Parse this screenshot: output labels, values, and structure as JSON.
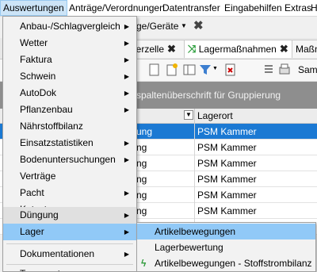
{
  "menubar": [
    "Auswertungen",
    "Anträge/Verordnungen",
    "Datentransfer",
    "Eingabehilfen",
    "Extras",
    "H"
  ],
  "toolbar1": {
    "combo_text": "ge/Geräte"
  },
  "tabs": [
    {
      "label": "gerzelle"
    },
    {
      "label": "Lagermaßnahmen"
    },
    {
      "label": "Maßn"
    }
  ],
  "toolbar2": {
    "partial_text": "Sam"
  },
  "groupbar_text": "spaltenüberschrift für Gruppierung ablegen",
  "grid": {
    "column_header": "Lagerort",
    "rows": [
      {
        "left": "ung",
        "lagerort": "PSM Kammer",
        "selected": true
      },
      {
        "left": "ng",
        "lagerort": "PSM Kammer",
        "selected": false
      },
      {
        "left": "ng",
        "lagerort": "PSM Kammer",
        "selected": false
      },
      {
        "left": "ng",
        "lagerort": "PSM Kammer",
        "selected": false
      },
      {
        "left": "ng",
        "lagerort": "PSM Kammer",
        "selected": false
      },
      {
        "left": "ng",
        "lagerort": "PSM Kammer",
        "selected": false
      },
      {
        "left": "ng",
        "lagerort": "PSM Kammer",
        "selected": false
      }
    ]
  },
  "menu": {
    "items": [
      {
        "label": "Anbau-/Schlagvergleich",
        "submenu": true
      },
      {
        "label": "Wetter",
        "submenu": true
      },
      {
        "label": "Faktura",
        "submenu": true
      },
      {
        "label": "Schwein",
        "submenu": true
      },
      {
        "label": "AutoDok",
        "submenu": true
      },
      {
        "label": "Pflanzenbau",
        "submenu": true
      },
      {
        "label": "Nährstoffbilanz",
        "submenu": false
      },
      {
        "label": "Einsatzstatistiken",
        "submenu": true
      },
      {
        "label": "Bodenuntersuchungen",
        "submenu": true
      },
      {
        "label": "Verträge",
        "submenu": false
      },
      {
        "label": "Pacht",
        "submenu": true
      },
      {
        "label": "Kataster",
        "submenu": true
      },
      {
        "label": "Düngung",
        "submenu": true
      },
      {
        "label": "Lager",
        "submenu": true
      },
      {
        "label": "Dokumentationen",
        "submenu": true
      },
      {
        "label": "Transport",
        "submenu": true
      }
    ]
  },
  "submenu": {
    "items": [
      {
        "label": "Artikelbewegungen"
      },
      {
        "label": "Lagerbewertung"
      },
      {
        "label": "Artikelbewegungen - Stoffstrombilanz",
        "icon": "lightning-icon"
      }
    ]
  },
  "colors": {
    "selection": "#1b79d3",
    "menu_highlight": "#91c9f7",
    "groupbar": "#8e8e8e"
  }
}
